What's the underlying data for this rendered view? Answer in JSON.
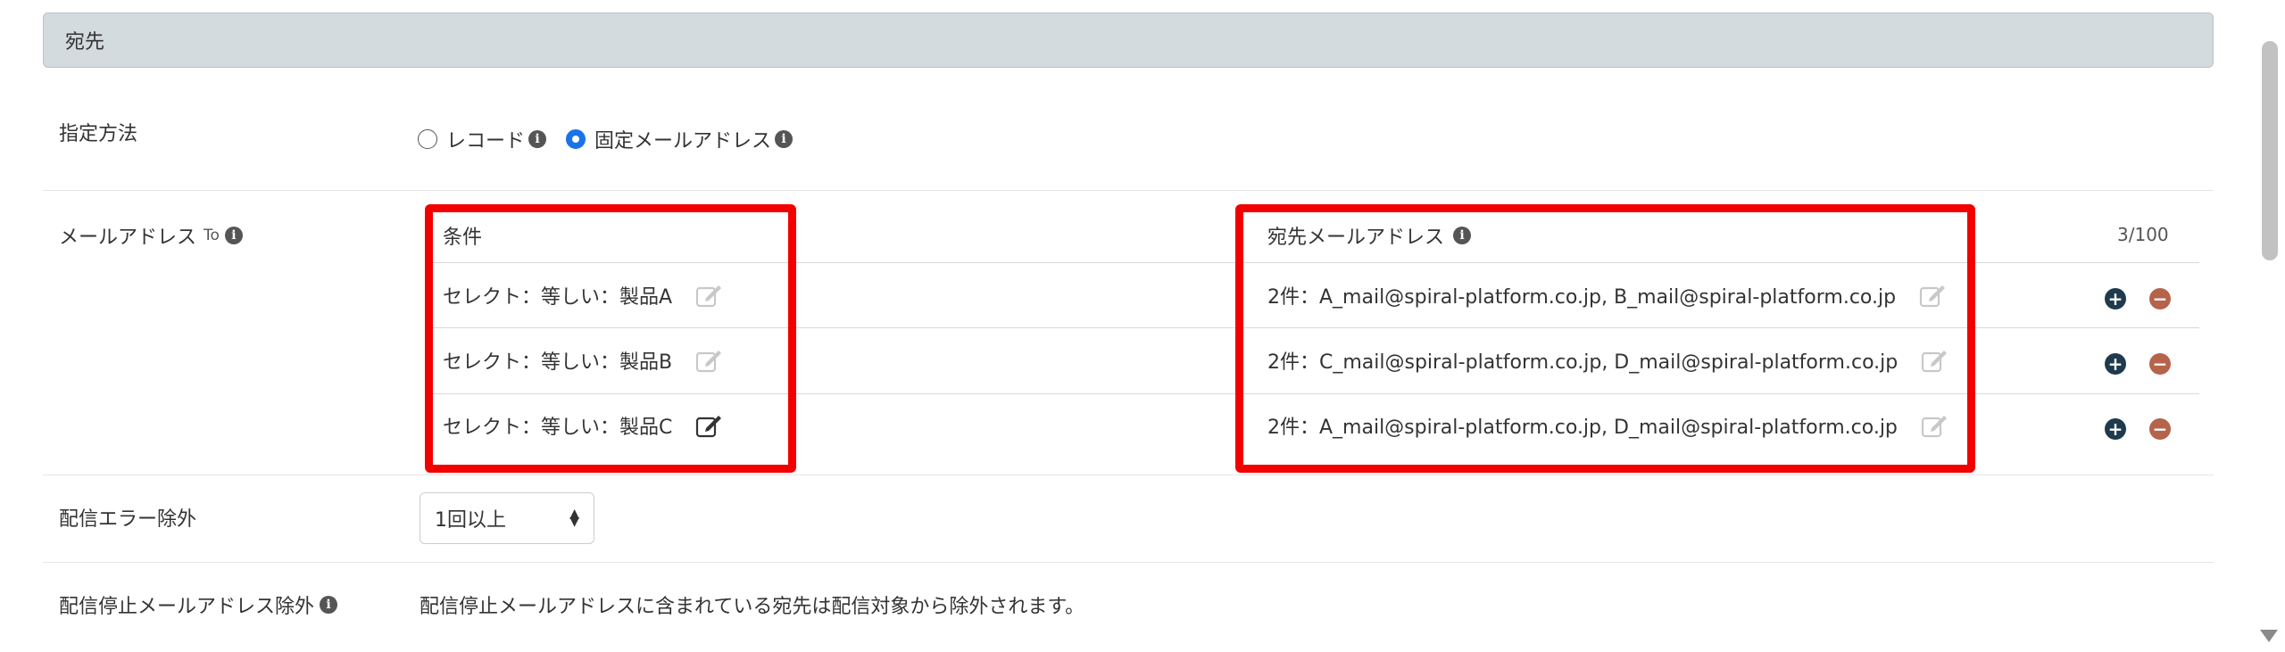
{
  "section": {
    "title": "宛先"
  },
  "method": {
    "label": "指定方法",
    "options": [
      {
        "label": "レコード",
        "checked": false
      },
      {
        "label": "固定メールアドレス",
        "checked": true
      }
    ]
  },
  "email_to": {
    "label": "メールアドレス",
    "sub_label": "To",
    "headers": {
      "condition": "条件",
      "address": "宛先メールアドレス"
    },
    "count": "3/100",
    "rows": [
      {
        "condition": "セレクト：等しい：製品A",
        "address": "2件：A_mail@spiral-platform.co.jp, B_mail@spiral-platform.co.jp",
        "condition_edit_active": false
      },
      {
        "condition": "セレクト：等しい：製品B",
        "address": "2件：C_mail@spiral-platform.co.jp, D_mail@spiral-platform.co.jp",
        "condition_edit_active": false
      },
      {
        "condition": "セレクト：等しい：製品C",
        "address": "2件：A_mail@spiral-platform.co.jp, D_mail@spiral-platform.co.jp",
        "condition_edit_active": true
      }
    ]
  },
  "delivery_error": {
    "label": "配信エラー除外",
    "selected": "1回以上"
  },
  "stop_exclusion": {
    "label": "配信停止メールアドレス除外",
    "description": "配信停止メールアドレスに含まれている宛先は配信対象から除外されます。"
  },
  "colors": {
    "highlight": "#f20000",
    "radio_checked": "#1a73e8",
    "add_button": "#1f3a4d",
    "remove_button": "#b5634b",
    "header_bg": "#d4dbdf"
  }
}
